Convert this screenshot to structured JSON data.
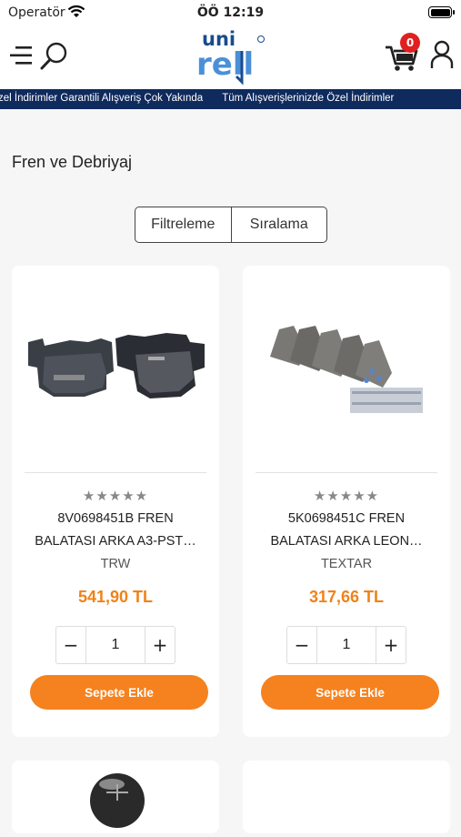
{
  "status_bar": {
    "carrier": "Operatör",
    "time": "ÖÖ 12:19"
  },
  "header": {
    "cart_count": "0",
    "logo_top": "uni",
    "logo_bottom": "rell"
  },
  "marquee": {
    "items": [
      "zel İndirimler Garantili Alışveriş Çok Yakında",
      "Tüm Alışverişlerinizde Özel İndirimler"
    ]
  },
  "page_title": "Fren ve Debriyaj",
  "filters": {
    "filter_label": "Filtreleme",
    "sort_label": "Sıralama"
  },
  "products": [
    {
      "name_line1": "8V0698451B FREN",
      "name_line2": "BALATASI ARKA A3-PST…",
      "brand": "TRW",
      "price": "541,90 TL",
      "quantity": "1",
      "add_label": "Sepete Ekle",
      "rating": 0
    },
    {
      "name_line1": "5K0698451C FREN",
      "name_line2": "BALATASI ARKA LEON…",
      "brand": "TEXTAR",
      "price": "317,66 TL",
      "quantity": "1",
      "add_label": "Sepete Ekle",
      "rating": 0
    }
  ],
  "colors": {
    "accent": "#f5821f",
    "navy": "#0f2a5c",
    "badge": "#e02020"
  }
}
